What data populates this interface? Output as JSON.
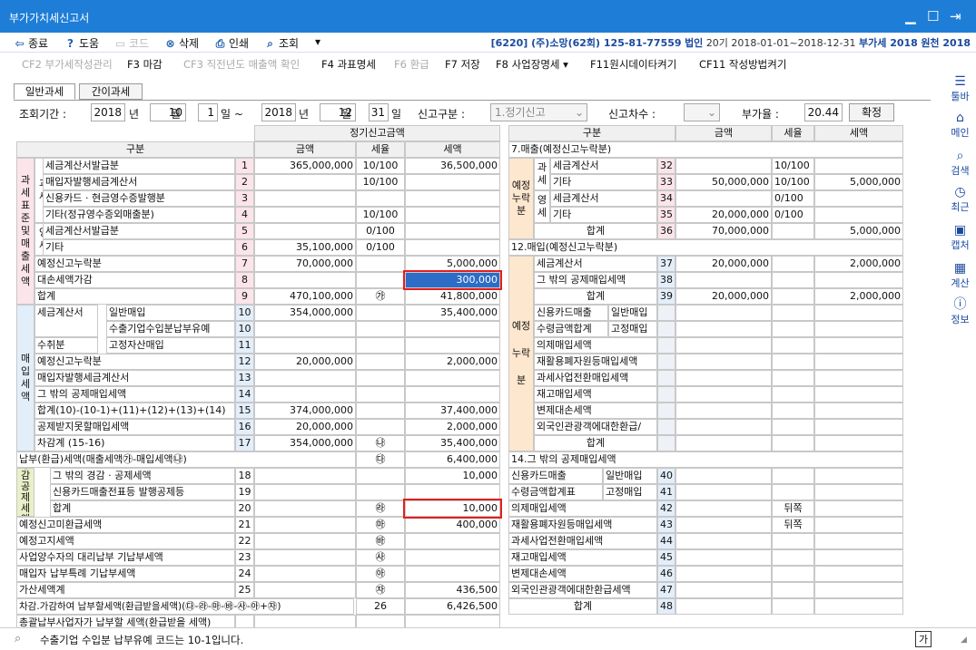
{
  "window": {
    "title": "부가가치세신고서"
  },
  "menu": {
    "items": [
      {
        "icon": "⇦",
        "label": "종료"
      },
      {
        "icon": "?",
        "label": "도움"
      },
      {
        "icon": "▭",
        "label": "코드"
      },
      {
        "icon": "⊗",
        "label": "삭제"
      },
      {
        "icon": "⎙",
        "label": "인쇄"
      },
      {
        "icon": "⌕",
        "label": "조회"
      }
    ],
    "more": "▾",
    "company": "[6220] (주)소망(62회) 125-81-77559",
    "corp": "법인",
    "period": "20기 2018-01-01~2018-12-31",
    "vat": "부가세 2018",
    "wonchun": "원천 2018"
  },
  "fkeys": [
    "CF2 부가세작성관리",
    "F3 마감",
    "CF3 직전년도 매출액 확인",
    "F4 과표명세",
    "F6 환급",
    "F7 저장",
    "F8 사업장명세 ▾",
    "F11원시데이타켜기",
    "CF11 작성방법켜기"
  ],
  "rightbar": [
    {
      "icon": "☰",
      "label": "툴바"
    },
    {
      "icon": "⌂",
      "label": "메인"
    },
    {
      "icon": "⌕",
      "label": "검색"
    },
    {
      "icon": "◷",
      "label": "최근"
    },
    {
      "icon": "▣",
      "label": "캡처"
    },
    {
      "icon": "▦",
      "label": "계산"
    },
    {
      "icon": "ⓘ",
      "label": "정보"
    }
  ],
  "tabs": [
    "일반과세",
    "간이과세"
  ],
  "cond": {
    "lookup_label": "조회기간 :",
    "y1": "2018",
    "w_year": "년",
    "m1": "10",
    "w_month": "월",
    "d1": "1",
    "w_day1": "일 ~",
    "y2": "2018",
    "w_year2": "년",
    "m2": "12",
    "w_month2": "월",
    "d2": "31",
    "w_day2": "일",
    "type_label": "신고구분 :",
    "type_value": "1.정기신고",
    "seq_label": "신고차수 :",
    "rate_label": "부가율 :",
    "rate": "20.44",
    "confirm": "확정"
  },
  "left": {
    "hdr_declared": "정기신고금액",
    "hdr_gubun": "구분",
    "hdr_amount": "금액",
    "hdr_rate": "세율",
    "hdr_tax": "세액",
    "side_tax": "과세표준및매출세액",
    "side_tax_sub1": "과세",
    "side_tax_sub2": "영세",
    "side_purchase": "매입세액",
    "side_deduct": "경감공제세액",
    "rows": [
      {
        "no": "1",
        "label": "세금계산서발급분",
        "amount": "365,000,000",
        "rate": "10/100",
        "tax": "36,500,000"
      },
      {
        "no": "2",
        "label": "매입자발행세금계산서",
        "amount": "",
        "rate": "10/100",
        "tax": ""
      },
      {
        "no": "3",
        "label": "신용카드 · 현금영수증발행분",
        "amount": "",
        "rate": "",
        "tax": ""
      },
      {
        "no": "4",
        "label": "기타(정규영수증외매출분)",
        "amount": "",
        "rate": "10/100",
        "tax": ""
      },
      {
        "no": "5",
        "label": "세금계산서발급분",
        "amount": "",
        "rate": "0/100",
        "tax": ""
      },
      {
        "no": "6",
        "label": "기타",
        "amount": "35,100,000",
        "rate": "0/100",
        "tax": ""
      },
      {
        "no": "7",
        "label": "예정신고누락분",
        "amount": "70,000,000",
        "rate": "",
        "tax": "5,000,000"
      },
      {
        "no": "8",
        "label": "대손세액가감",
        "amount": "",
        "rate": "",
        "tax": "300,000"
      },
      {
        "no": "9",
        "label": "합계",
        "amount": "470,100,000",
        "rate": "㉮",
        "tax": "41,800,000"
      },
      {
        "no": "10",
        "label": "일반매입",
        "amount": "354,000,000",
        "rate": "",
        "tax": "35,400,000"
      },
      {
        "no": "10",
        "label": "수출기업수입분납부유예",
        "amount": "",
        "rate": "",
        "tax": ""
      },
      {
        "no": "11",
        "label": "고정자산매입",
        "amount": "",
        "rate": "",
        "tax": ""
      },
      {
        "no": "12",
        "label": "예정신고누락분",
        "amount": "20,000,000",
        "rate": "",
        "tax": "2,000,000"
      },
      {
        "no": "13",
        "label": "매입자발행세금계산서",
        "amount": "",
        "rate": "",
        "tax": ""
      },
      {
        "no": "14",
        "label": "그 밖의 공제매입세액",
        "amount": "",
        "rate": "",
        "tax": ""
      },
      {
        "no": "15",
        "label": "합계(10)-(10-1)+(11)+(12)+(13)+(14)",
        "amount": "374,000,000",
        "rate": "",
        "tax": "37,400,000"
      },
      {
        "no": "16",
        "label": "공제받지못할매입세액",
        "amount": "20,000,000",
        "rate": "",
        "tax": "2,000,000"
      },
      {
        "no": "17",
        "label": "차감계 (15-16)",
        "amount": "354,000,000",
        "rate": "㉯",
        "tax": "35,400,000"
      },
      {
        "no": "",
        "label": "납부(환급)세액(매출세액㉮-매입세액㉯)",
        "amount": "",
        "rate": "㉰",
        "tax": "6,400,000"
      },
      {
        "no": "18",
        "label": "그 밖의 경감 · 공제세액",
        "amount": "",
        "rate": "",
        "tax": "10,000"
      },
      {
        "no": "19",
        "label": "신용카드매출전표등 발행공제등",
        "amount": "",
        "rate": "",
        "tax": ""
      },
      {
        "no": "20",
        "label": "합계",
        "amount": "",
        "rate": "㉱",
        "tax": "10,000"
      },
      {
        "no": "21",
        "label": "예정신고미환급세액",
        "amount": "",
        "rate": "㉲",
        "tax": "400,000"
      },
      {
        "no": "22",
        "label": "예정고지세액",
        "amount": "",
        "rate": "㉳",
        "tax": ""
      },
      {
        "no": "23",
        "label": "사업양수자의 대리납부 기납부세액",
        "amount": "",
        "rate": "㉴",
        "tax": ""
      },
      {
        "no": "24",
        "label": "매입자 납부특례 기납부세액",
        "amount": "",
        "rate": "㉵",
        "tax": ""
      },
      {
        "no": "25",
        "label": "가산세액계",
        "amount": "",
        "rate": "㉶",
        "tax": "436,500"
      },
      {
        "no": "26",
        "label": "차감.가감하여 납부할세액(환급받을세액)(㉰-㉱-㉲-㉳-㉴-㉵+㉶)",
        "amount": "",
        "rate": "",
        "tax": "6,426,500"
      },
      {
        "no": "",
        "label": "총괄납부사업자가 납부할 세액(환급받을 세액)",
        "amount": "",
        "rate": "",
        "tax": ""
      }
    ],
    "sub_invoice": "세금계산서",
    "sub_received": "수취분"
  },
  "right": {
    "hdr_gubun": "구분",
    "hdr_amount": "금액",
    "hdr_rate": "세율",
    "hdr_tax": "세액",
    "sec7": "7.매출(예정신고누락분)",
    "side7": "예정누락분",
    "side7_sub1": "과세",
    "side7_sub2": "영세",
    "rows7": [
      {
        "no": "32",
        "label": "세금계산서",
        "amount": "",
        "rate": "10/100",
        "tax": ""
      },
      {
        "no": "33",
        "label": "기타",
        "amount": "50,000,000",
        "rate": "10/100",
        "tax": "5,000,000"
      },
      {
        "no": "34",
        "label": "세금계산서",
        "amount": "",
        "rate": "0/100",
        "tax": ""
      },
      {
        "no": "35",
        "label": "기타",
        "amount": "20,000,000",
        "rate": "0/100",
        "tax": ""
      },
      {
        "no": "36",
        "label": "합계",
        "amount": "70,000,000",
        "rate": "",
        "tax": "5,000,000"
      }
    ],
    "sec12": "12.매입(예정신고누락분)",
    "side12": "예정누락분",
    "rows12": [
      {
        "no": "37",
        "label": "세금계산서",
        "amount": "20,000,000",
        "rate": "",
        "tax": "2,000,000"
      },
      {
        "no": "38",
        "label": "그 밖의 공제매입세액",
        "amount": "",
        "rate": "",
        "tax": ""
      },
      {
        "no": "39",
        "label": "합계",
        "amount": "20,000,000",
        "rate": "",
        "tax": "2,000,000"
      }
    ],
    "card_a": "신용카드매출",
    "card_b": "수령금액합계",
    "card_general": "일반매입",
    "card_fixed": "고정매입",
    "extra12": [
      "의제매입세액",
      "재활용폐자원등매입세액",
      "과세사업전환매입세액",
      "재고매입세액",
      "변제대손세액",
      "외국인관광객에대한환급/"
    ],
    "total12": "합계",
    "sec14": "14.그 밖의 공제매입세액",
    "card14_a": "신용카드매출",
    "card14_b": "수령금액합계표",
    "card14_general": "일반매입",
    "card14_fixed": "고정매입",
    "rows14": [
      {
        "no": "40",
        "label": ""
      },
      {
        "no": "41",
        "label": ""
      },
      {
        "no": "42",
        "label": "의제매입세액",
        "rate": "뒤쪽"
      },
      {
        "no": "43",
        "label": "재활용폐자원등매입세액",
        "rate": "뒤쪽"
      },
      {
        "no": "44",
        "label": "과세사업전환매입세액"
      },
      {
        "no": "45",
        "label": "재고매입세액"
      },
      {
        "no": "46",
        "label": "변제대손세액"
      },
      {
        "no": "47",
        "label": "외국인관광객에대한환급세액"
      },
      {
        "no": "48",
        "label": "합계"
      }
    ]
  },
  "status": {
    "text": "수출기업 수입분 납부유예 코드는 10-1입니다.",
    "ime": "가"
  }
}
